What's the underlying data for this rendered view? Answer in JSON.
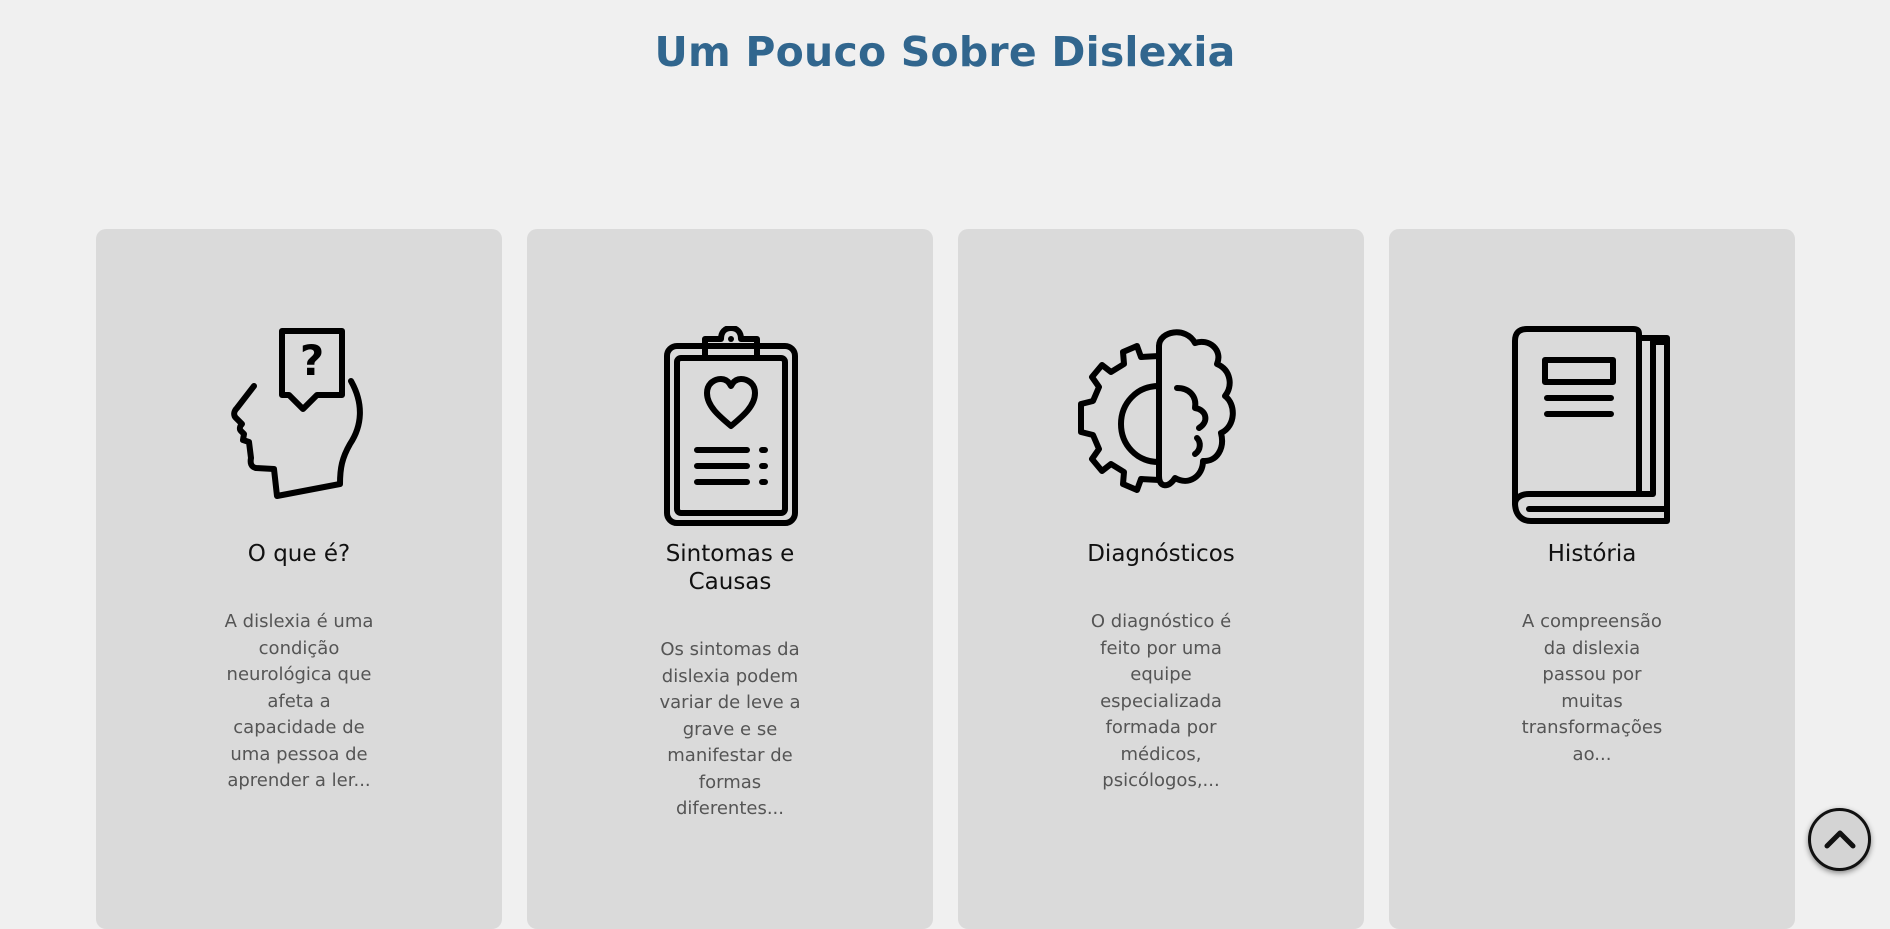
{
  "header": {
    "title": "Um Pouco Sobre Dislexia"
  },
  "cards": [
    {
      "icon": "head-question-icon",
      "title": "O que é?",
      "text": "A dislexia é uma condição neurológica que afeta a capacidade de uma pessoa de aprender a ler..."
    },
    {
      "icon": "clipboard-heart-icon",
      "title": "Sintomas e Causas",
      "text": "Os sintomas da dislexia podem variar de leve a grave e se manifestar de formas diferentes..."
    },
    {
      "icon": "brain-gear-icon",
      "title": "Diagnósticos",
      "text": "O diagnóstico é feito por uma equipe especializada formada por médicos, psicólogos,..."
    },
    {
      "icon": "book-icon",
      "title": "História",
      "text": "A compreensão da dislexia passou por muitas transformações ao..."
    }
  ],
  "scroll_top": {
    "icon": "chevron-up-icon"
  },
  "colors": {
    "background": "#f0f0f0",
    "card": "#dadada",
    "title": "#31668e",
    "text": "#555555"
  }
}
